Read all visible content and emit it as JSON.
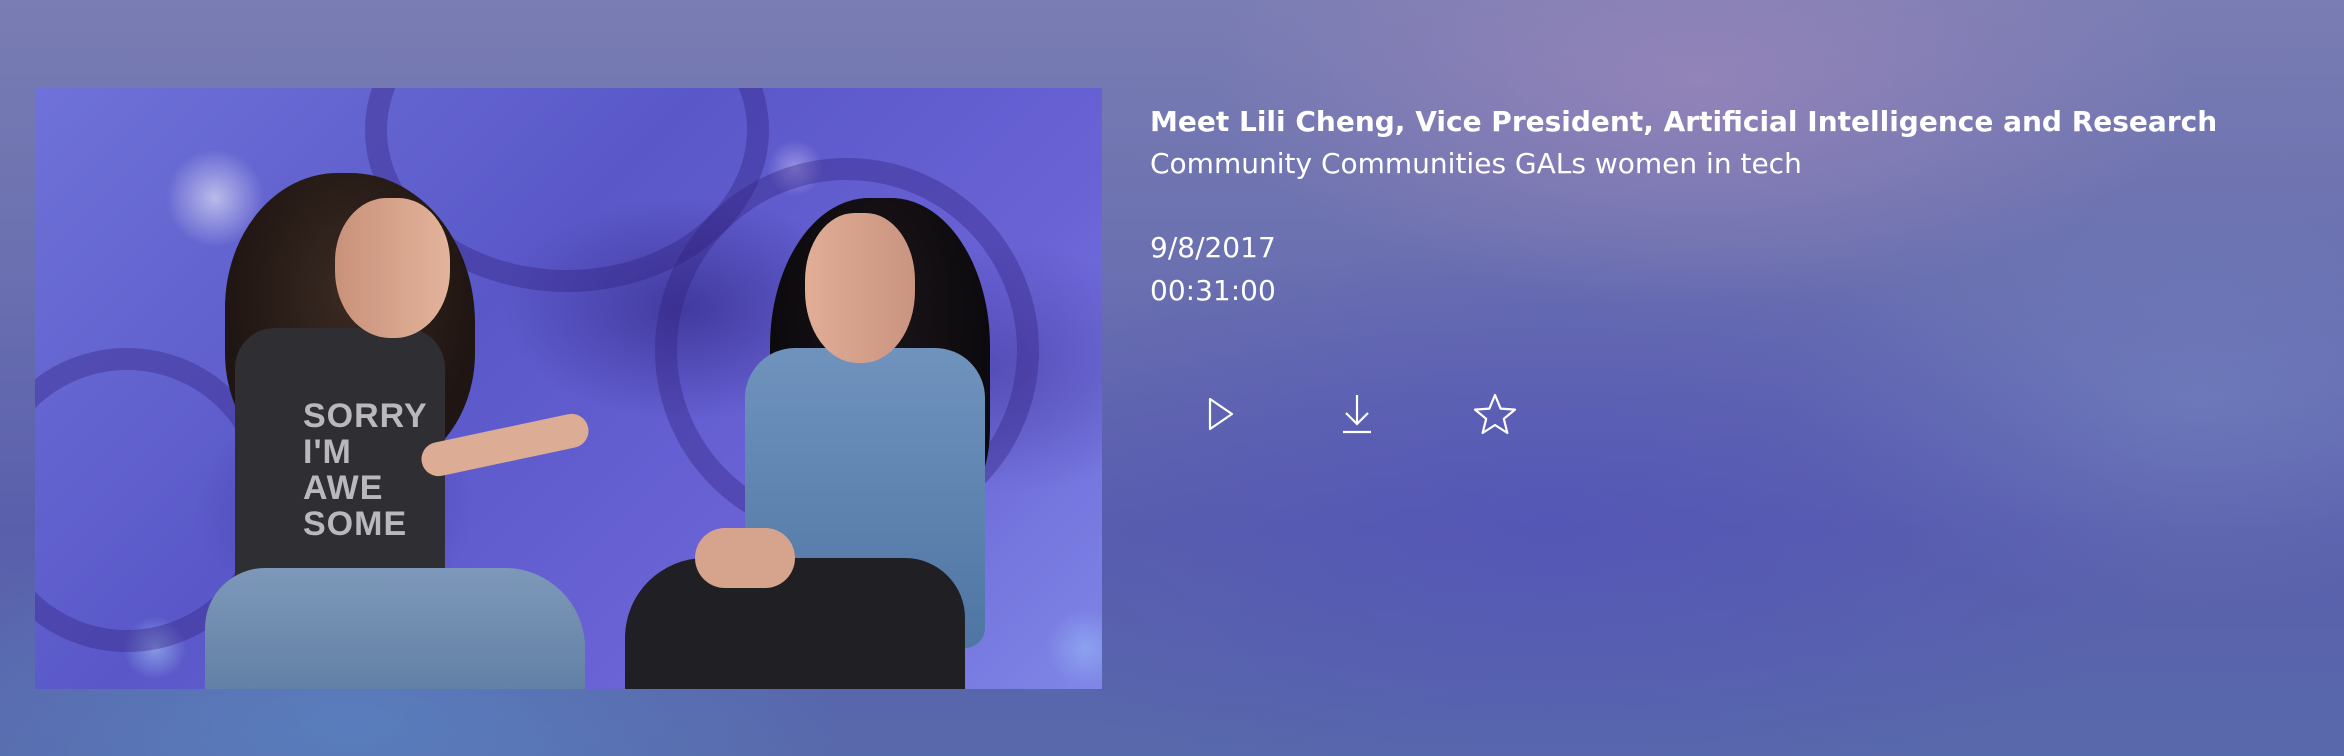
{
  "video": {
    "title": "Meet Lili Cheng, Vice President, Artificial Intelligence and Research",
    "tags": "Community Communities GALs women in tech",
    "date": "9/8/2017",
    "duration": "00:31:00",
    "thumbnail": {
      "shirt_text_lines": [
        "SORRY",
        "I'M",
        "AWE",
        "SOME"
      ]
    }
  },
  "actions": {
    "play": {
      "icon": "play-icon"
    },
    "download": {
      "icon": "download-icon"
    },
    "favorite": {
      "icon": "star-icon"
    }
  },
  "theme": {
    "text_color": "#ffffff",
    "background_accent": "#6a70b0"
  }
}
